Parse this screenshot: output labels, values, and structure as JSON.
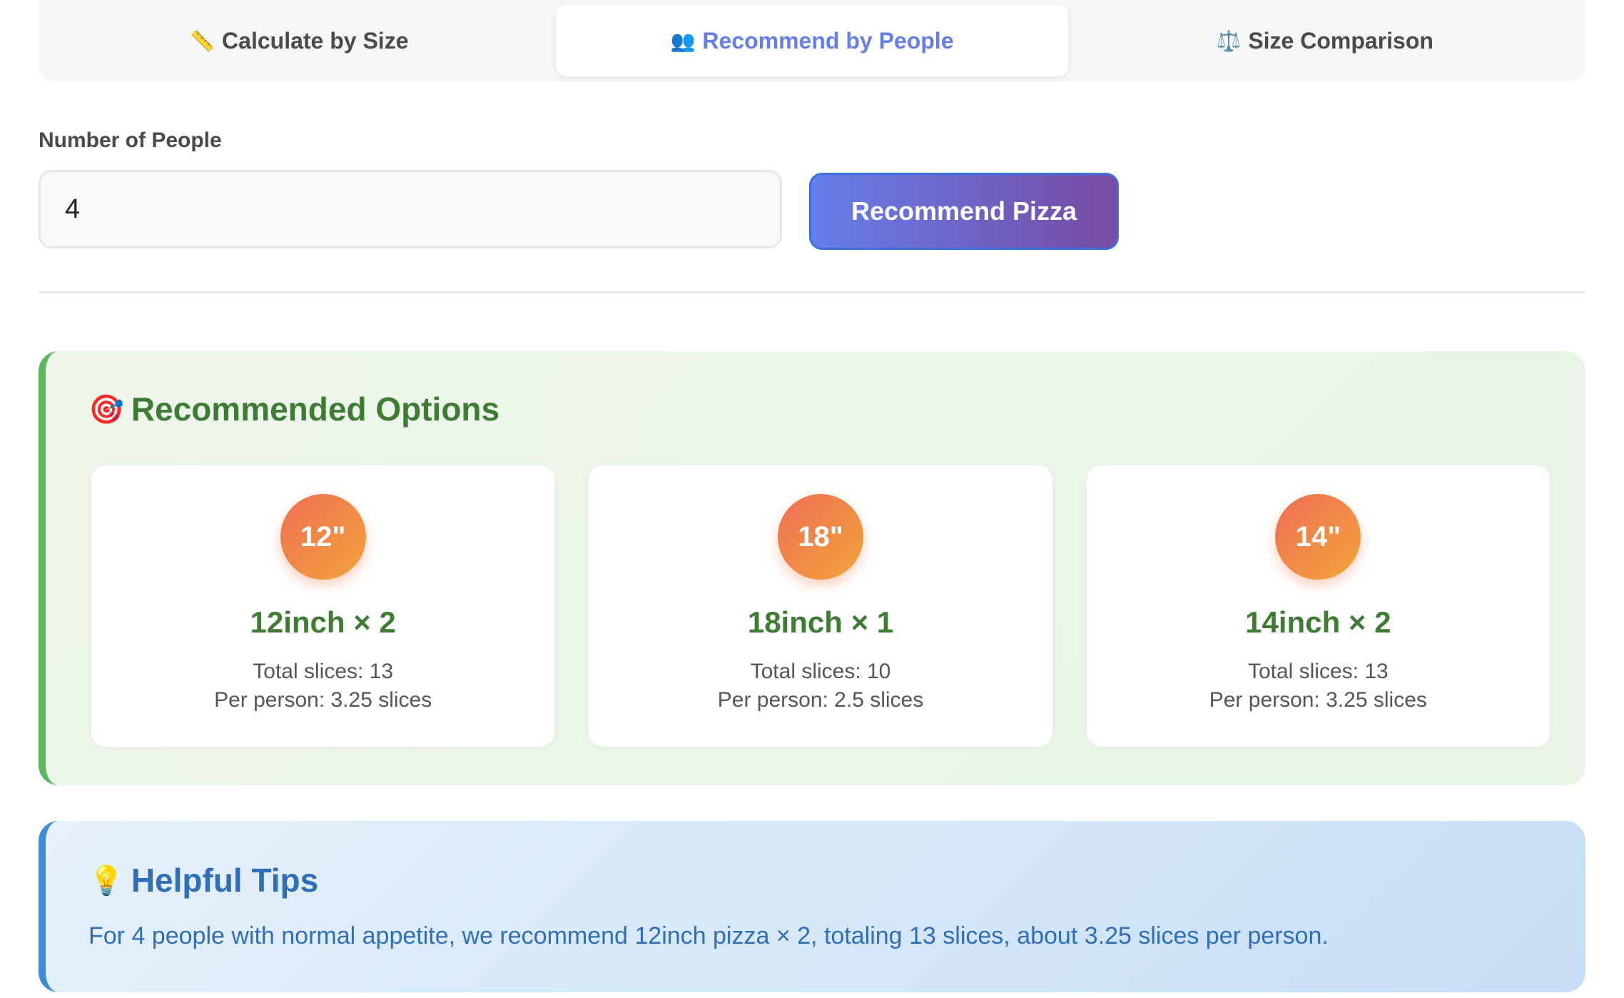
{
  "tabs": [
    {
      "icon": "📏",
      "label": "Calculate by Size",
      "active": false
    },
    {
      "icon": "👥",
      "label": "Recommend by People",
      "active": true
    },
    {
      "icon": "⚖️",
      "label": "Size Comparison",
      "active": false
    }
  ],
  "form": {
    "people_label": "Number of People",
    "people_value": "4",
    "submit_label": "Recommend Pizza"
  },
  "recommendations": {
    "icon": "🎯",
    "title": "Recommended Options",
    "options": [
      {
        "badge": "12\"",
        "title": "12inch × 2",
        "total": "Total slices: 13",
        "per_person": "Per person: 3.25 slices"
      },
      {
        "badge": "18\"",
        "title": "18inch × 1",
        "total": "Total slices: 10",
        "per_person": "Per person: 2.5 slices"
      },
      {
        "badge": "14\"",
        "title": "14inch × 2",
        "total": "Total slices: 13",
        "per_person": "Per person: 3.25 slices"
      }
    ]
  },
  "tips": {
    "icon": "💡",
    "title": "Helpful Tips",
    "text": "For 4 people with normal appetite, we recommend 12inch pizza × 2, totaling 13 slices, about 3.25 slices per person."
  },
  "colors": {
    "accent": "#667eea",
    "green": "#3e7b33",
    "blue": "#2f6eb8",
    "orange": "#f08a4b"
  }
}
